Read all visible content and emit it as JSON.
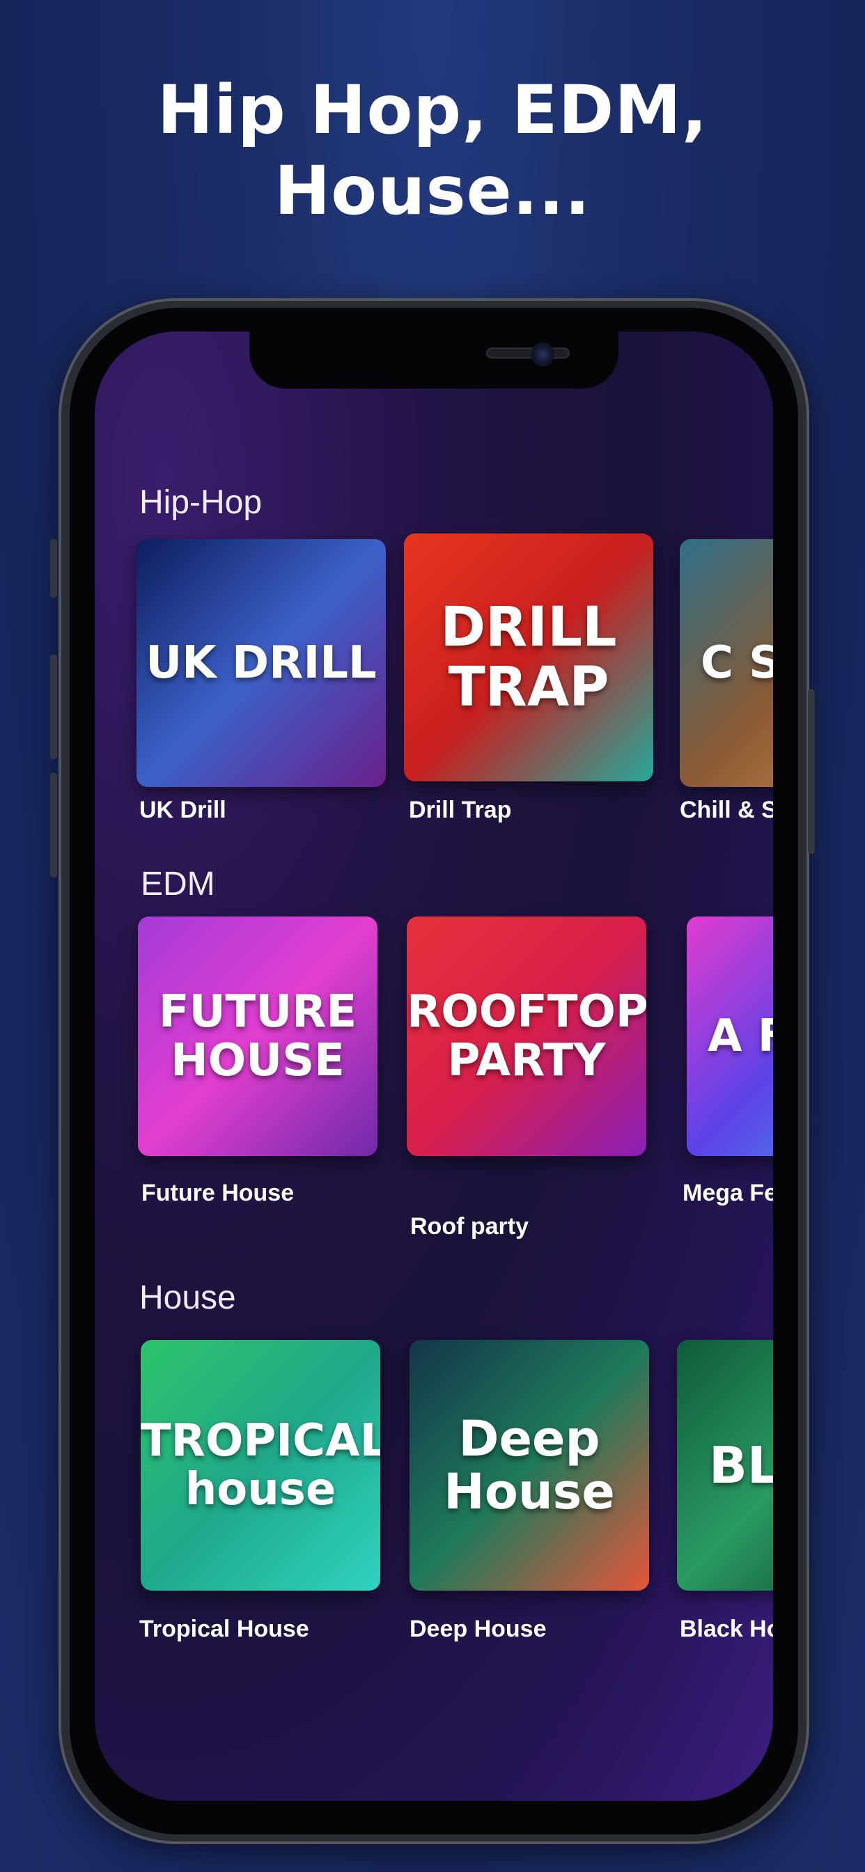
{
  "headline": {
    "line1": "Hip Hop, EDM,",
    "line2": "House..."
  },
  "sections": [
    {
      "title": "Hip-Hop",
      "items": [
        {
          "label": "UK Drill",
          "art_text": "UK DRILL",
          "colors": [
            "#0e1d5e",
            "#3c61c8",
            "#6a1f8a"
          ]
        },
        {
          "label": "Drill Trap",
          "art_text": "DRILL TRAP",
          "colors": [
            "#e8351f",
            "#c81f1f",
            "#25a89a"
          ]
        },
        {
          "label": "Chill & S",
          "art_text": "C STU",
          "colors": [
            "#2f6f88",
            "#8a5a34",
            "#cf8d4e"
          ]
        }
      ]
    },
    {
      "title": "EDM",
      "items": [
        {
          "label": "Future House",
          "art_text": "FUTURE HOUSE",
          "colors": [
            "#a53bd8",
            "#e23ed0",
            "#6d2aa8"
          ]
        },
        {
          "label": "Roof party",
          "art_text": "ROOFTOP PARTY",
          "colors": [
            "#e8303b",
            "#d81f4a",
            "#8a1fb8"
          ]
        },
        {
          "label": "Mega Fe",
          "art_text": "A FES",
          "colors": [
            "#e13ccf",
            "#5d42e8",
            "#3f9ee6"
          ]
        }
      ]
    },
    {
      "title": "House",
      "items": [
        {
          "label": "Tropical House",
          "art_text": "TROPICAL house",
          "colors": [
            "#2dc46a",
            "#1fa88a",
            "#2fd3c0"
          ]
        },
        {
          "label": "Deep House",
          "art_text": "Deep House",
          "colors": [
            "#14364a",
            "#1e7a5a",
            "#e6553a"
          ]
        },
        {
          "label": "Black Ho",
          "art_text": "BL H DI",
          "colors": [
            "#0f5a3a",
            "#2a9a62",
            "#0e3d2a"
          ]
        }
      ]
    }
  ]
}
